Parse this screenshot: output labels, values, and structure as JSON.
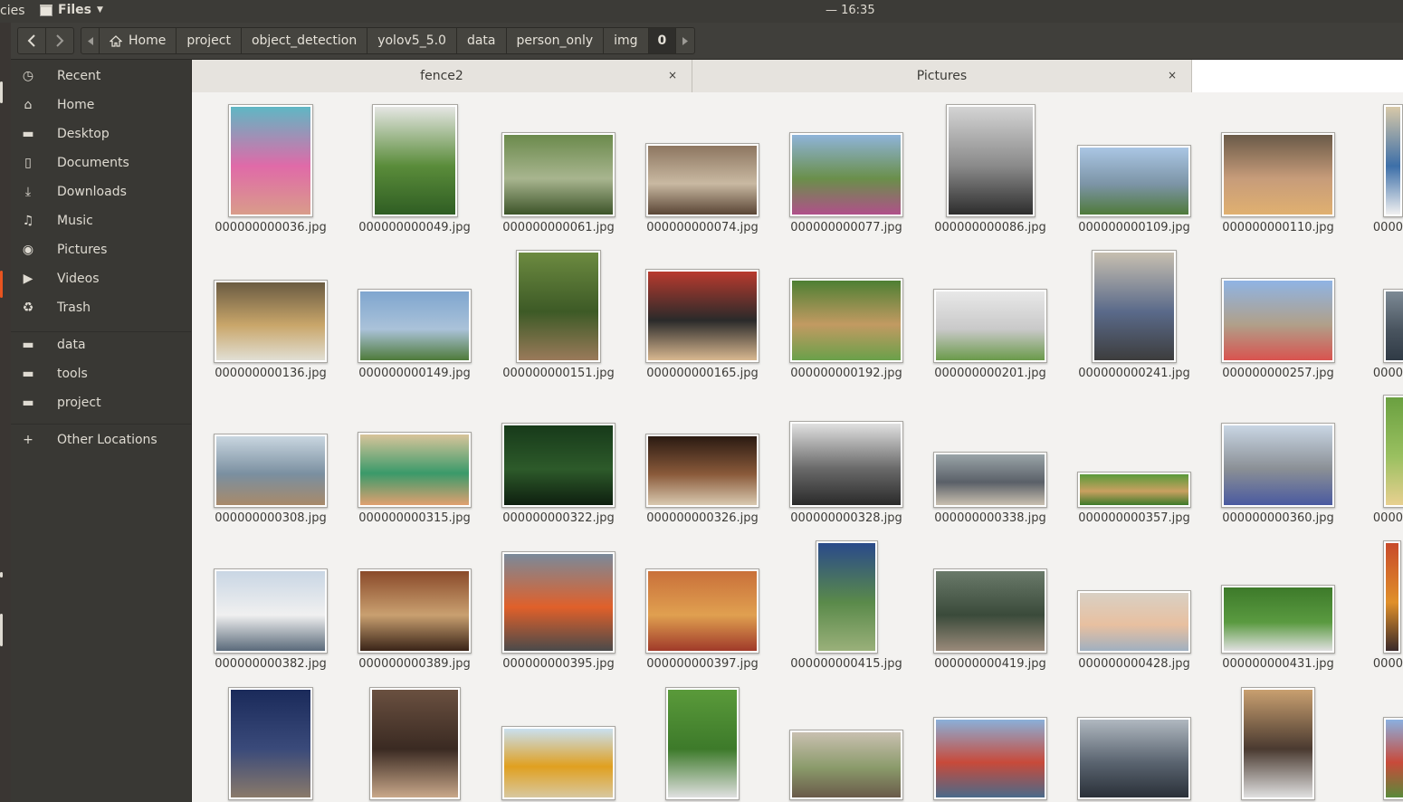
{
  "topbar": {
    "activities_label": "cies",
    "app_name": "Files",
    "clock": "— 16:35"
  },
  "toolbar": {
    "back_icon": "chevron-left-icon",
    "forward_icon": "chevron-right-icon"
  },
  "pathbar": {
    "home_label": "Home",
    "crumbs": [
      "project",
      "object_detection",
      "yolov5_5.0",
      "data",
      "person_only",
      "img"
    ],
    "current": "0"
  },
  "sidebar": {
    "places": [
      {
        "label": "Recent",
        "icon": "clock-icon"
      },
      {
        "label": "Home",
        "icon": "home-icon"
      },
      {
        "label": "Desktop",
        "icon": "folder-icon"
      },
      {
        "label": "Documents",
        "icon": "document-icon"
      },
      {
        "label": "Downloads",
        "icon": "download-icon"
      },
      {
        "label": "Music",
        "icon": "music-icon"
      },
      {
        "label": "Pictures",
        "icon": "camera-icon"
      },
      {
        "label": "Videos",
        "icon": "video-icon"
      },
      {
        "label": "Trash",
        "icon": "trash-icon"
      }
    ],
    "bookmarks": [
      {
        "label": "data",
        "icon": "folder-icon"
      },
      {
        "label": "tools",
        "icon": "folder-icon"
      },
      {
        "label": "project",
        "icon": "folder-icon"
      }
    ],
    "other_locations": {
      "label": "Other Locations",
      "icon": "plus-icon"
    }
  },
  "tabs": [
    {
      "label": "fence2",
      "close": "×"
    },
    {
      "label": "Pictures",
      "close": "×"
    },
    {
      "label": ""
    }
  ],
  "files": [
    {
      "name": "000000000036.jpg",
      "colors": [
        "#5fb7c4",
        "#e06aa8",
        "#d99c8a"
      ]
    },
    {
      "name": "000000000049.jpg",
      "colors": [
        "#e5e6e3",
        "#5a8c3a",
        "#2f5d23"
      ]
    },
    {
      "name": "000000000061.jpg",
      "colors": [
        "#6b8a4c",
        "#a8b58f",
        "#3d5429"
      ]
    },
    {
      "name": "000000000074.jpg",
      "colors": [
        "#8d7660",
        "#c9b9a2",
        "#5a4535"
      ]
    },
    {
      "name": "000000000077.jpg",
      "colors": [
        "#8fb4d9",
        "#6a8f4a",
        "#b0508a"
      ]
    },
    {
      "name": "000000000086.jpg",
      "colors": [
        "#d4d4d4",
        "#8a8a8a",
        "#2d2d2d"
      ]
    },
    {
      "name": "000000000109.jpg",
      "colors": [
        "#aac6e4",
        "#7c94a6",
        "#4f7a3a"
      ]
    },
    {
      "name": "000000000110.jpg",
      "colors": [
        "#6a5a48",
        "#c79c7a",
        "#e0b070"
      ]
    },
    {
      "name": "0000",
      "colors": [
        "#d8c9a8",
        "#3d6fa8",
        "#f0f0f0"
      ]
    },
    {
      "name": "000000000136.jpg",
      "colors": [
        "#6a5b42",
        "#c9a66a",
        "#e1dfd4"
      ]
    },
    {
      "name": "000000000149.jpg",
      "colors": [
        "#7fa6cf",
        "#aac2d9",
        "#4e7a3a"
      ]
    },
    {
      "name": "000000000151.jpg",
      "colors": [
        "#6c8a40",
        "#3d5a26",
        "#9a7a5a"
      ]
    },
    {
      "name": "000000000165.jpg",
      "colors": [
        "#b83a2e",
        "#2a2a2a",
        "#d9b890"
      ]
    },
    {
      "name": "000000000192.jpg",
      "colors": [
        "#4e7f33",
        "#c29a62",
        "#6aa04a"
      ]
    },
    {
      "name": "000000000201.jpg",
      "colors": [
        "#e8e8e8",
        "#c9c9c9",
        "#6a9a4a"
      ]
    },
    {
      "name": "000000000241.jpg",
      "colors": [
        "#c7bfb0",
        "#5a6a8a",
        "#3d3d3d"
      ]
    },
    {
      "name": "000000000257.jpg",
      "colors": [
        "#8fb4e4",
        "#b0a08a",
        "#d9534f"
      ]
    },
    {
      "name": "0000",
      "colors": [
        "#7d8a95",
        "#4a5560",
        "#2f3a45"
      ]
    },
    {
      "name": "000000000308.jpg",
      "colors": [
        "#c9d6e0",
        "#7a8fa0",
        "#a88a6a"
      ]
    },
    {
      "name": "000000000315.jpg",
      "colors": [
        "#d8c49a",
        "#3a9a6a",
        "#e0a070"
      ]
    },
    {
      "name": "000000000322.jpg",
      "colors": [
        "#173a1a",
        "#2d5a2a",
        "#0e1f0f"
      ]
    },
    {
      "name": "000000000326.jpg",
      "colors": [
        "#2a1a12",
        "#8a5a3a",
        "#d9c9b0"
      ]
    },
    {
      "name": "000000000328.jpg",
      "colors": [
        "#e0e0e0",
        "#6a6a6a",
        "#2a2a2a"
      ]
    },
    {
      "name": "000000000338.jpg",
      "colors": [
        "#9aa4a8",
        "#5a6068",
        "#c9c0b0"
      ]
    },
    {
      "name": "000000000357.jpg",
      "colors": [
        "#5a9a3a",
        "#c9a060",
        "#3d7a2a"
      ]
    },
    {
      "name": "000000000360.jpg",
      "colors": [
        "#c9d6e4",
        "#8a8f95",
        "#4a5aa0"
      ]
    },
    {
      "name": "0000",
      "colors": [
        "#6aa040",
        "#9ac060",
        "#e8d090"
      ]
    },
    {
      "name": "000000000382.jpg",
      "colors": [
        "#c9d6e4",
        "#f0f0f0",
        "#5a6a7a"
      ]
    },
    {
      "name": "000000000389.jpg",
      "colors": [
        "#8a4a2a",
        "#c9a070",
        "#3a2418"
      ]
    },
    {
      "name": "000000000395.jpg",
      "colors": [
        "#7a8a9a",
        "#e0602a",
        "#4a4a4a"
      ]
    },
    {
      "name": "000000000397.jpg",
      "colors": [
        "#c9703a",
        "#e0a050",
        "#a03a2a"
      ]
    },
    {
      "name": "000000000415.jpg",
      "colors": [
        "#2a4a8a",
        "#5a8a4a",
        "#9ab07a"
      ]
    },
    {
      "name": "000000000419.jpg",
      "colors": [
        "#6a7a6a",
        "#3a4a3a",
        "#9a8a7a"
      ]
    },
    {
      "name": "000000000428.jpg",
      "colors": [
        "#d9d0c4",
        "#e8c0a0",
        "#a0b0c0"
      ]
    },
    {
      "name": "000000000431.jpg",
      "colors": [
        "#3d7a2a",
        "#5a9a40",
        "#e0e0e0"
      ]
    },
    {
      "name": "0000",
      "colors": [
        "#c84a2a",
        "#e0902a",
        "#3a2a2a"
      ]
    },
    {
      "name": "",
      "colors": [
        "#1a2a5a",
        "#3a4a7a",
        "#8a7a6a"
      ]
    },
    {
      "name": "",
      "colors": [
        "#6a5040",
        "#3a2a22",
        "#c9a88a"
      ]
    },
    {
      "name": "",
      "colors": [
        "#c9e0f0",
        "#e0a020",
        "#d8c8a0"
      ]
    },
    {
      "name": "",
      "colors": [
        "#5a9a3a",
        "#3d7a2a",
        "#e0e0e0"
      ]
    },
    {
      "name": "",
      "colors": [
        "#c9c0b0",
        "#8a9a6a",
        "#6a5a4a"
      ]
    },
    {
      "name": "",
      "colors": [
        "#8ab0d9",
        "#c84a3a",
        "#4a6a8a"
      ]
    },
    {
      "name": "",
      "colors": [
        "#b0b8c0",
        "#5a6470",
        "#2a3038"
      ]
    },
    {
      "name": "",
      "colors": [
        "#c9a070",
        "#4a3a30",
        "#e0e0e0"
      ]
    },
    {
      "name": "",
      "colors": [
        "#8ab0e0",
        "#c84a3a",
        "#5a8a3a"
      ]
    }
  ]
}
